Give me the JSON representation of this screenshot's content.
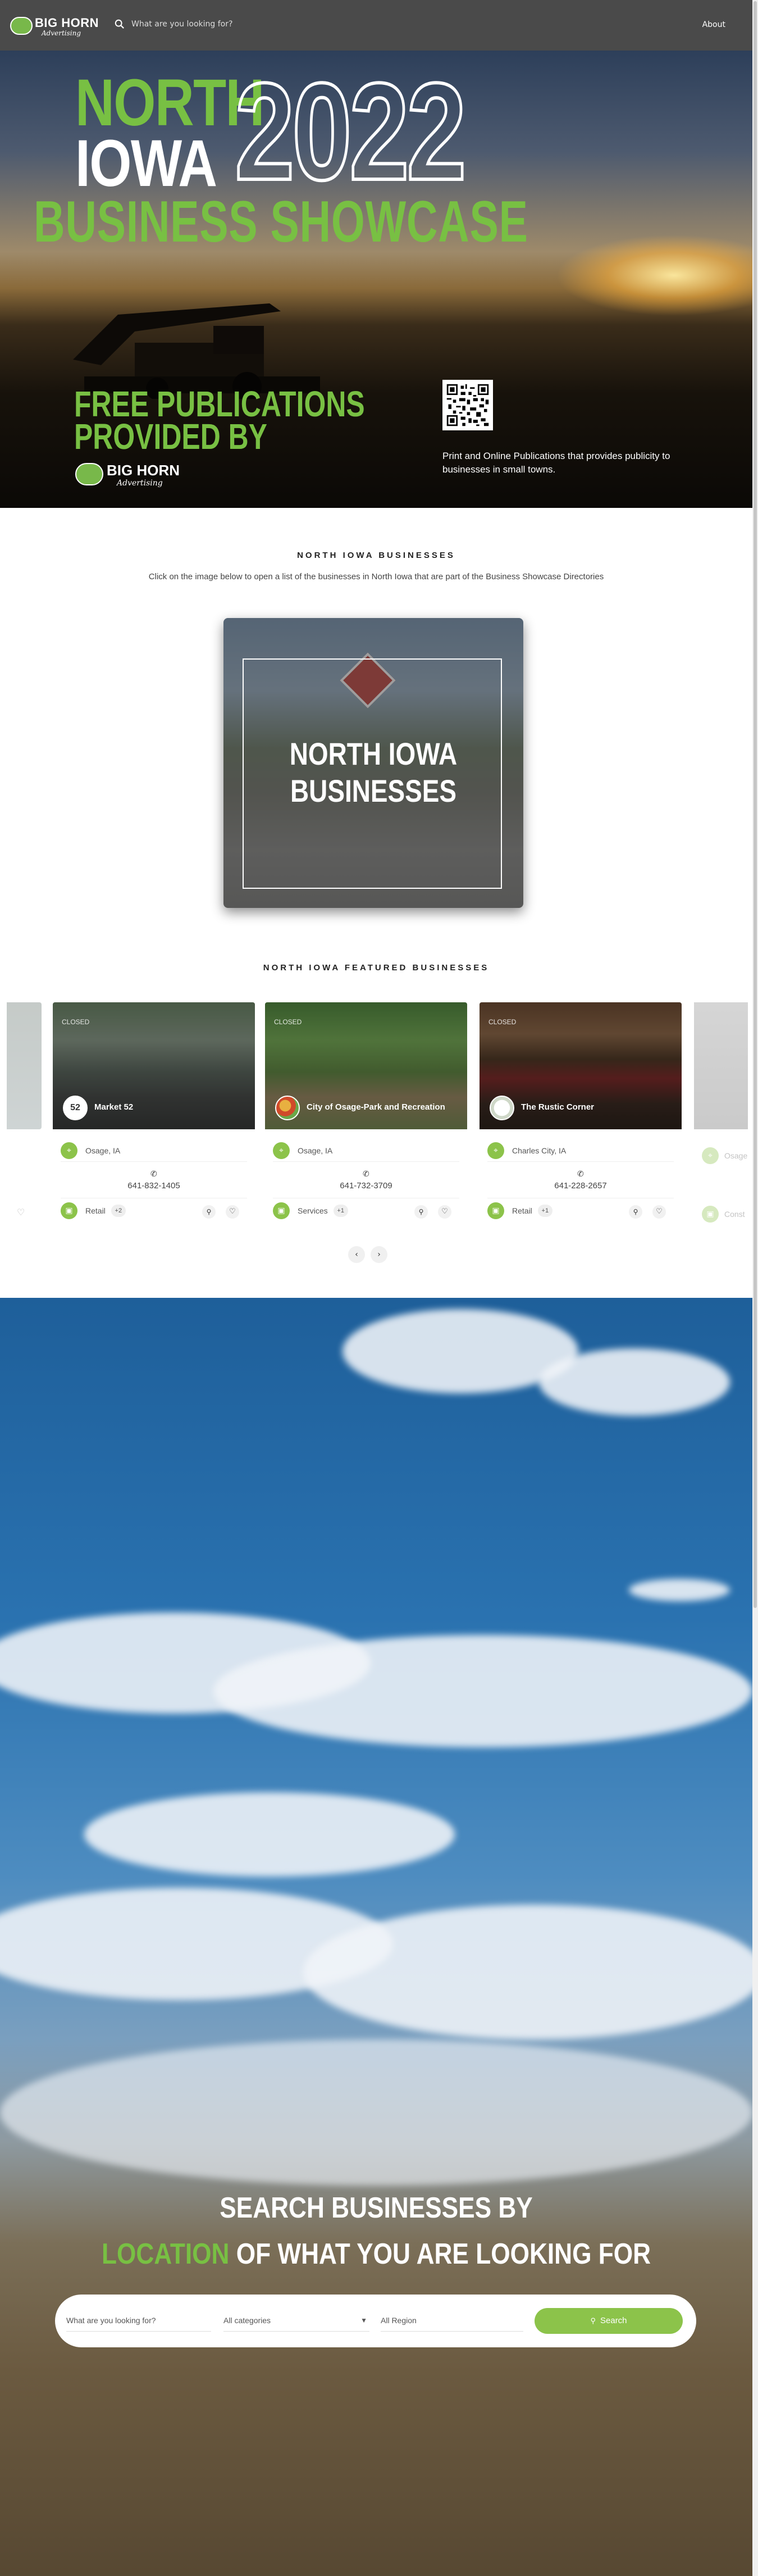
{
  "header": {
    "logo_name": "BIG HORN",
    "logo_sub": "Advertising",
    "search_placeholder": "What are you looking for?",
    "about_label": "About"
  },
  "hero": {
    "north": "NORTH",
    "iowa": "IOWA",
    "year": "2022",
    "showcase": "BUSINESS SHOWCASE",
    "free_line1": "FREE PUBLICATIONS",
    "free_line2": "PROVIDED BY",
    "logo_name": "BIG HORN",
    "logo_sub": "Advertising",
    "qr_text": "Print and Online Publications that provides publicity to businesses in small towns."
  },
  "businesses": {
    "title": "NORTH IOWA BUSINESSES",
    "description": "Click on the image below to open a list of the businesses in North Iowa that are part of the Business Showcase Directories",
    "card_line1": "NORTH IOWA",
    "card_line2": "BUSINESSES"
  },
  "featured": {
    "title": "NORTH IOWA FEATURED BUSINESSES",
    "closed_label": "CLOSED",
    "cards": [
      {
        "name": "Market 52",
        "location": "Osage, IA",
        "phone": "641-832-1405",
        "category": "Retail",
        "more": "+2",
        "avatar_text": "52"
      },
      {
        "name": "City of Osage-Park and Recreation",
        "location": "Osage, IA",
        "phone": "641-732-3709",
        "category": "Services",
        "more": "+1",
        "avatar_text": ""
      },
      {
        "name": "The Rustic Corner",
        "location": "Charles City, IA",
        "phone": "641-228-2657",
        "category": "Retail",
        "more": "+1",
        "avatar_text": ""
      }
    ],
    "faded_location": "Osage",
    "faded_category": "Const",
    "prev": "‹",
    "next": "›"
  },
  "search": {
    "line1": "SEARCH BUSINESSES BY",
    "line2_highlight": "LOCATION",
    "line2_rest": " OF WHAT YOU ARE LOOKING FOR",
    "keyword_placeholder": "What are you looking for?",
    "category_value": "All categories",
    "region_value": "All Region",
    "button_label": "Search"
  },
  "colors": {
    "brand_green": "#78c043",
    "button_green": "#8cc34a",
    "header_bg": "#4a4a4a"
  }
}
